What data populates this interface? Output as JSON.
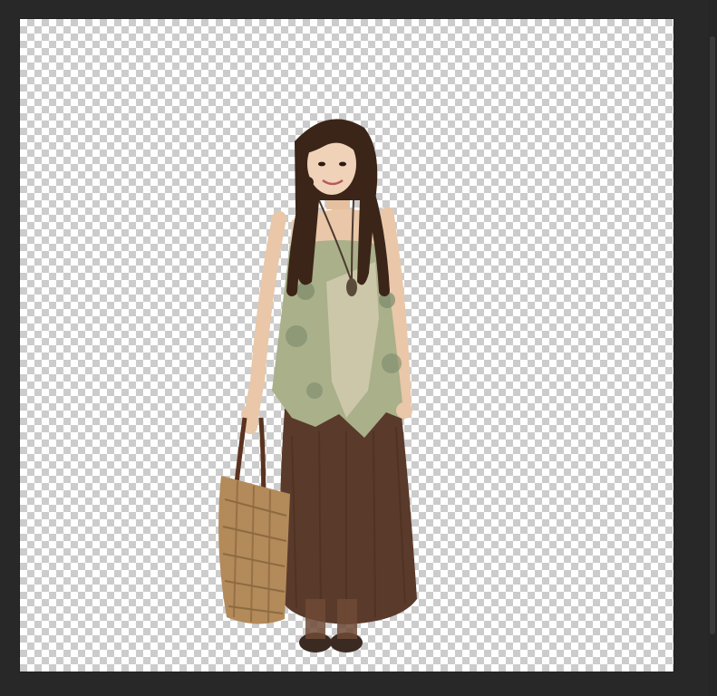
{
  "app": {
    "theme": "dark",
    "workspace_color": "#282828"
  },
  "canvas": {
    "background": "transparency-checkerboard",
    "layer_content": "cutout-person-with-straw-tote-bag"
  },
  "icons": {
    "subject": "person-cutout-image",
    "bag": "straw-tote-bag-image"
  },
  "colors": {
    "checker_light": "#ffffff",
    "checker_dark": "#cccccc",
    "skirt": "#5a3a2a",
    "top": "#a9b08a",
    "hair": "#3b2418",
    "bag": "#b38a5a"
  }
}
